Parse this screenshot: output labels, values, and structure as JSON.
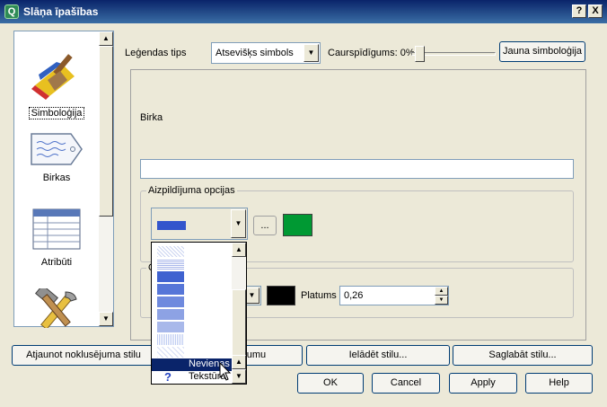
{
  "window": {
    "title": "Slāņa īpašības",
    "help_button": "?",
    "close_button": "X"
  },
  "sidebar": {
    "items": [
      {
        "label": "Simboloģija",
        "icon": "brush-icon"
      },
      {
        "label": "Birkas",
        "icon": "label-tag-icon"
      },
      {
        "label": "Atribūti",
        "icon": "table-icon"
      },
      {
        "label": "",
        "icon": "tools-icon"
      }
    ]
  },
  "symbology": {
    "legend_type_label": "Leģendas tips",
    "legend_type_value": "Atsevišķs simbols",
    "transparency_label": "Caurspīdīgums: 0%",
    "transparency_percent": 0,
    "new_symbology_button": "Jauna simboloģija",
    "label_field_label": "Birka",
    "label_field_value": "",
    "fill_options_title": "Aizpildījuma opcijas",
    "fill_options_more_button": "...",
    "fill_color": "#009933",
    "outline_options_title": "O",
    "outline_color": "#000000",
    "width_label": "Platums",
    "width_value": "0,26"
  },
  "dropdown": {
    "options": [
      {
        "label": "Nevienas",
        "selected": true,
        "icon": "no-fill-icon"
      },
      {
        "label": "Tekstūra",
        "selected": false,
        "icon": "texture-question-icon"
      }
    ]
  },
  "buttons": {
    "restore_default_style": "Atjaunot noklusējuma stilu",
    "save_as_default": "Kā noklusējumu",
    "load_style": "Ielādēt stilu...",
    "save_style": "Saglabāt stilu...",
    "ok": "OK",
    "cancel": "Cancel",
    "apply": "Apply",
    "help": "Help"
  },
  "colors": {
    "title_bar": "#0a246a",
    "fill_swatch_dropdown": "#3355cc",
    "selection": "#0a246a"
  }
}
